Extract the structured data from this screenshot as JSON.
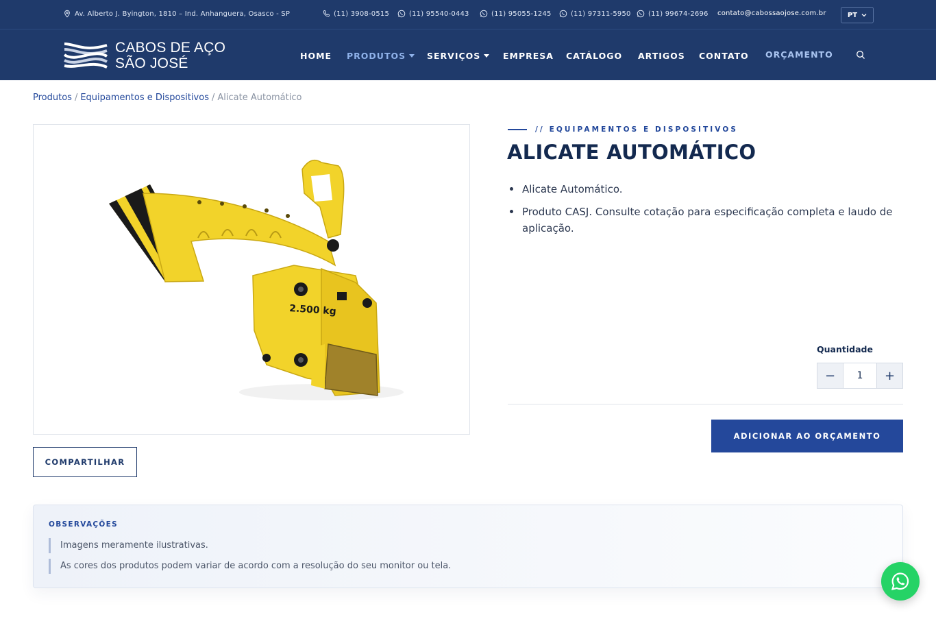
{
  "topbar": {
    "address": "Av. Alberto J. Byington, 1810 – Ind. Anhanguera, Osasco - SP",
    "phone": "(11) 3908-0515",
    "whatsapp_1": "(11) 95540-0443",
    "whatsapp_2": "(11) 95055-1245",
    "whatsapp_3": "(11) 97311-5950",
    "whatsapp_4": "(11) 99674-2696",
    "email": "contato@cabossaojose.com.br",
    "language": "PT"
  },
  "brand": {
    "line1": "CABOS DE AÇO",
    "line2": "SÃO JOSÉ"
  },
  "nav": {
    "home": "HOME",
    "produtos": "PRODUTOS",
    "servicos": "SERVIÇOS",
    "empresa": "EMPRESA",
    "catalogo": "CATÁLOGO",
    "artigos": "ARTIGOS",
    "contato": "CONTATO",
    "orcamento": "ORÇAMENTO"
  },
  "breadcrumb": {
    "level1": "Produtos",
    "level2": "Equipamentos e Dispositivos",
    "current": "Alicate Automático",
    "separator": "/"
  },
  "product": {
    "category": "// EQUIPAMENTOS E DISPOSITIVOS",
    "title": "ALICATE AUTOMÁTICO",
    "bullets": [
      "Alicate Automático.",
      "Produto CASJ. Consulte cotação para especificação completa e laudo de aplicação."
    ],
    "image_label": "2.500 kg",
    "share_label": "COMPARTILHAR",
    "quantity_label": "Quantidade",
    "quantity_value": "1",
    "qty_minus": "−",
    "qty_plus": "+",
    "add_label": "ADICIONAR AO ORÇAMENTO"
  },
  "observations": {
    "title": "OBSERVAÇÕES",
    "notes": [
      "Imagens meramente ilustrativas.",
      "As cores dos produtos podem variar de acordo com a resolução do seu monitor ou tela."
    ]
  },
  "colors": {
    "header_bg": "#1f3a6b",
    "accent": "#24489b",
    "product_yellow": "#f2d32a",
    "whatsapp": "#25d366"
  },
  "icons": [
    "location-pin-icon",
    "phone-icon",
    "whatsapp-icon",
    "chevron-down-icon",
    "search-icon",
    "brand-logo-icon"
  ]
}
